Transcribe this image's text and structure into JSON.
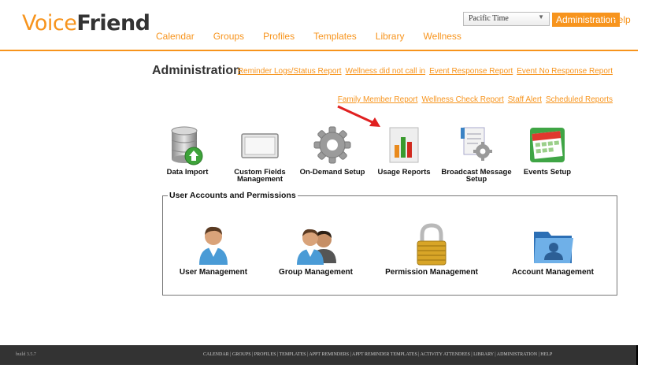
{
  "logo": {
    "part1": "Voice",
    "part2": "Friend"
  },
  "nav": [
    "Calendar",
    "Groups",
    "Profiles",
    "Templates",
    "Library",
    "Wellness"
  ],
  "timezone": {
    "selected": "Pacific Time"
  },
  "header_buttons": {
    "admin": "Administration",
    "help": "Help"
  },
  "page_title": "Administration",
  "report_links_row1": [
    "Reminder Logs/Status Report",
    "Wellness did not call in",
    "Event Response Report",
    "Event No Response Report"
  ],
  "report_links_row2": [
    "Family Member Report",
    "Wellness Check Report",
    "Staff Alert",
    "Scheduled Reports"
  ],
  "tools": [
    {
      "label": "Data Import",
      "icon": "database-import-icon"
    },
    {
      "label": "Custom Fields Management",
      "icon": "window-frame-icon"
    },
    {
      "label": "On-Demand Setup",
      "icon": "gear-icon"
    },
    {
      "label": "Usage Reports",
      "icon": "bar-chart-report-icon"
    },
    {
      "label": "Broadcast Message Setup",
      "icon": "document-gear-icon"
    },
    {
      "label": "Events Setup",
      "icon": "calendar-events-icon"
    }
  ],
  "accounts_section": {
    "legend": "User Accounts and Permissions",
    "items": [
      {
        "label": "User Management",
        "icon": "user-icon"
      },
      {
        "label": "Group Management",
        "icon": "group-users-icon"
      },
      {
        "label": "Permission Management",
        "icon": "padlock-icon"
      },
      {
        "label": "Account Management",
        "icon": "user-folder-icon"
      }
    ]
  },
  "colors": {
    "accent": "#f7941d",
    "footer_bg": "#333333"
  },
  "footer": {
    "build": "build 3.5.7",
    "links": "CALENDAR | GROUPS | PROFILES | TEMPLATES | APPT REMINDERS | APPT REMINDER TEMPLATES | ACTIVITY ATTENDEES | LIBRARY | ADMINISTRATION | HELP"
  }
}
